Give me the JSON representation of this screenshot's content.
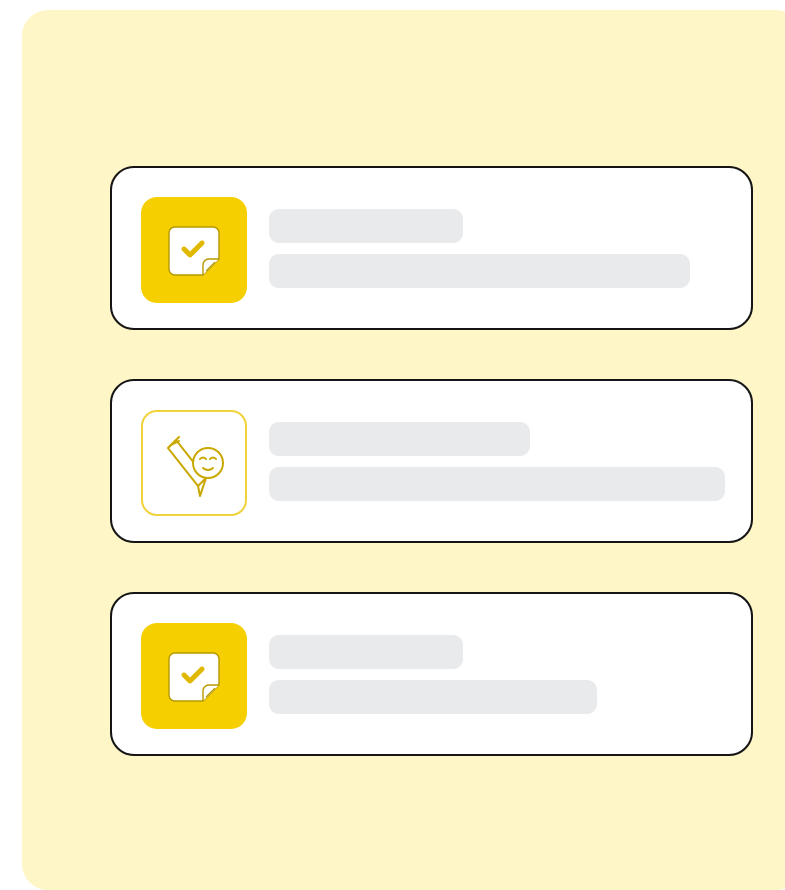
{
  "cards": [
    {
      "icon": "checklist-note-icon",
      "icon_style": "filled"
    },
    {
      "icon": "pencil-smiley-icon",
      "icon_style": "outline"
    },
    {
      "icon": "checklist-note-icon",
      "icon_style": "filled"
    }
  ],
  "colors": {
    "panel_background": "#fff6c8",
    "card_border": "#151515",
    "accent_yellow": "#f6cf00",
    "skeleton_gray": "#e9eaec"
  }
}
